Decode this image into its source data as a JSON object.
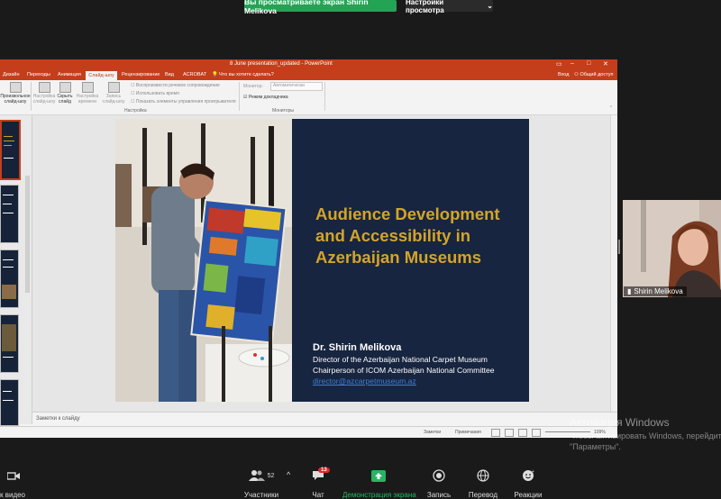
{
  "zoom": {
    "share_banner": "Вы просматриваете экран Shirin Melikova",
    "view_options": "Настройки просмотра",
    "participant_name": "Shirin Melikova",
    "toolbar": {
      "video_label": "к видео",
      "participants_label": "Участники",
      "participants_count": "52",
      "chat_label": "Чат",
      "chat_badge": "13",
      "share_label": "Демонстрация экрана",
      "record_label": "Запись",
      "translate_label": "Перевод",
      "reactions_label": "Реакции"
    }
  },
  "powerpoint": {
    "window_title": "8 June presentation_updated - PowerPoint",
    "tabs": [
      "Дизайн",
      "Переходы",
      "Анимация",
      "Слайд-шоу",
      "Рецензирование",
      "Вид",
      "ACROBAT"
    ],
    "active_tab": "Слайд-шоу",
    "tell_me": "Что вы хотите сделать?",
    "sign_in": "Вход",
    "share": "Общий доступ",
    "ribbon": {
      "custom_show": "Произвольное слайд-шоу",
      "setup_show": "Настройка слайд-шоу",
      "hide_slide": "Скрыть слайд",
      "rehearse": "Настройка времени",
      "record_show": "Запись слайд-шоу",
      "play_narrations": "Воспроизвести речевое сопровождение",
      "use_timings": "Использовать время",
      "show_media_controls": "Показать элементы управления проигрывателя",
      "group_setup": "Настройка",
      "monitor_label": "Монитор:",
      "monitor_value": "Автоматически",
      "presenter_view": "Режим докладчика",
      "group_monitors": "Мониторы"
    },
    "notes_placeholder": "Заметки к слайду",
    "status": {
      "notes": "Заметки",
      "comments": "Примечания",
      "zoom": "109%"
    }
  },
  "slide": {
    "title": "Audience Development and Accessibility in Azerbaijan Museums",
    "presenter": "Dr. Shirin Melikova",
    "role1": "Director of the Azerbaijan National Carpet Museum",
    "role2": "Chairperson of ICOM Azerbaijan National Committee",
    "email": "director@azcarpetmuseum.az"
  },
  "watermark": {
    "title": "Активация Windows",
    "line1": "Чтобы активировать Windows, перейдите",
    "line2": "\"Параметры\"."
  },
  "colors": {
    "banner_green": "#23a455",
    "ppt_red": "#c43e1c",
    "slide_navy": "#172540",
    "slide_gold": "#d3a42a"
  }
}
